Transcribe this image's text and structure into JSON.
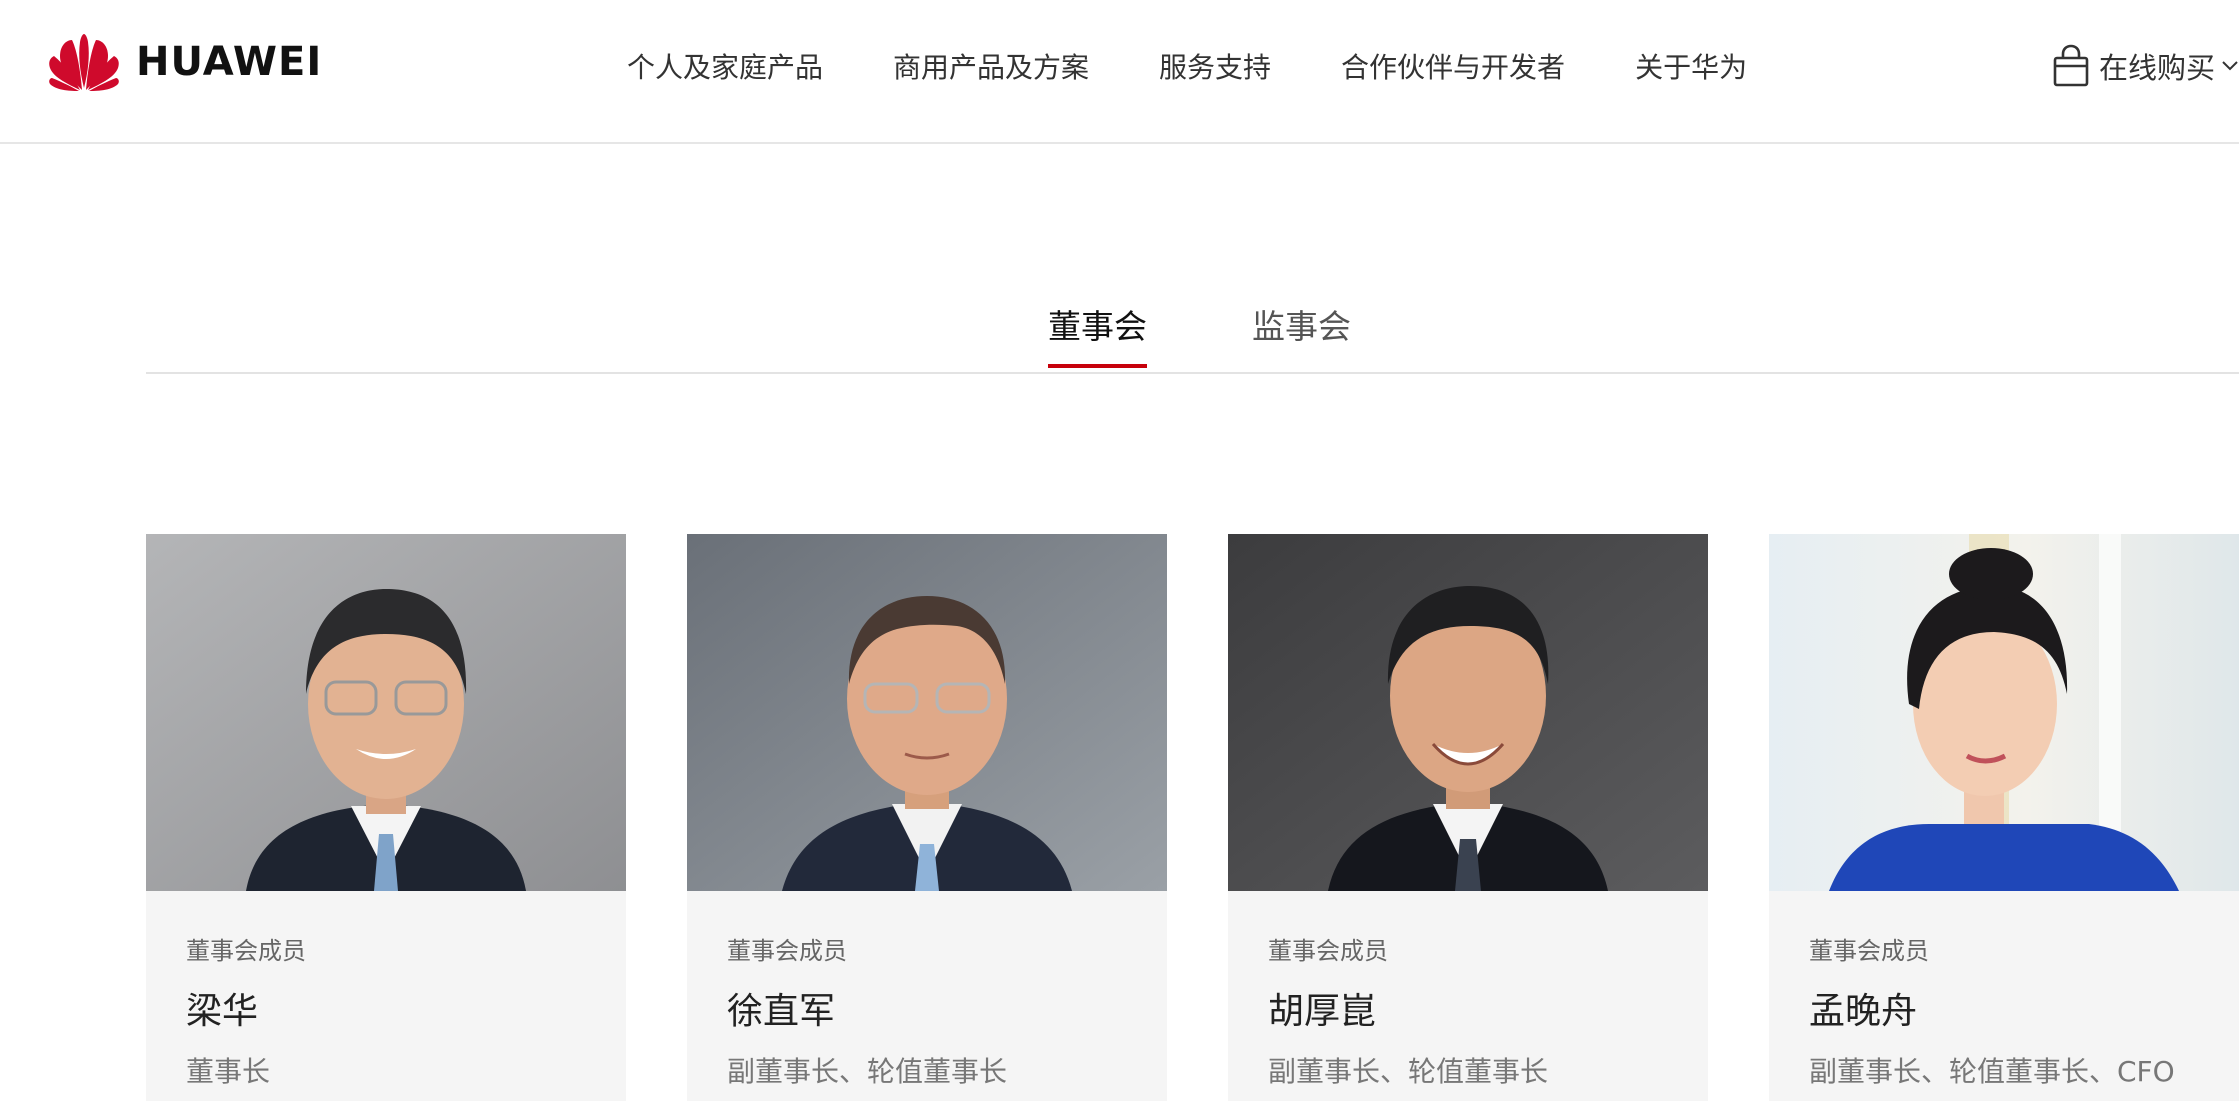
{
  "header": {
    "brand": "HUAWEI",
    "nav": [
      {
        "label": "个人及家庭产品"
      },
      {
        "label": "商用产品及方案"
      },
      {
        "label": "服务支持"
      },
      {
        "label": "合作伙伴与开发者"
      },
      {
        "label": "关于华为"
      }
    ],
    "buy_label": "在线购买"
  },
  "tabs": [
    {
      "label": "董事会",
      "active": true
    },
    {
      "label": "监事会",
      "active": false
    }
  ],
  "members": [
    {
      "tag": "董事会成员",
      "name": "梁华",
      "title": "董事长"
    },
    {
      "tag": "董事会成员",
      "name": "徐直军",
      "title": "副董事长、轮值董事长"
    },
    {
      "tag": "董事会成员",
      "name": "胡厚崑",
      "title": "副董事长、轮值董事长"
    },
    {
      "tag": "董事会成员",
      "name": "孟晚舟",
      "title": "副董事长、轮值董事长、CFO"
    }
  ],
  "colors": {
    "brand_red": "#c7000b",
    "card_bg": "#f5f5f5"
  },
  "icons": {
    "logo": "huawei-flower-logo",
    "cart": "shopping-bag-icon",
    "dropdown": "chevron-down-icon"
  }
}
